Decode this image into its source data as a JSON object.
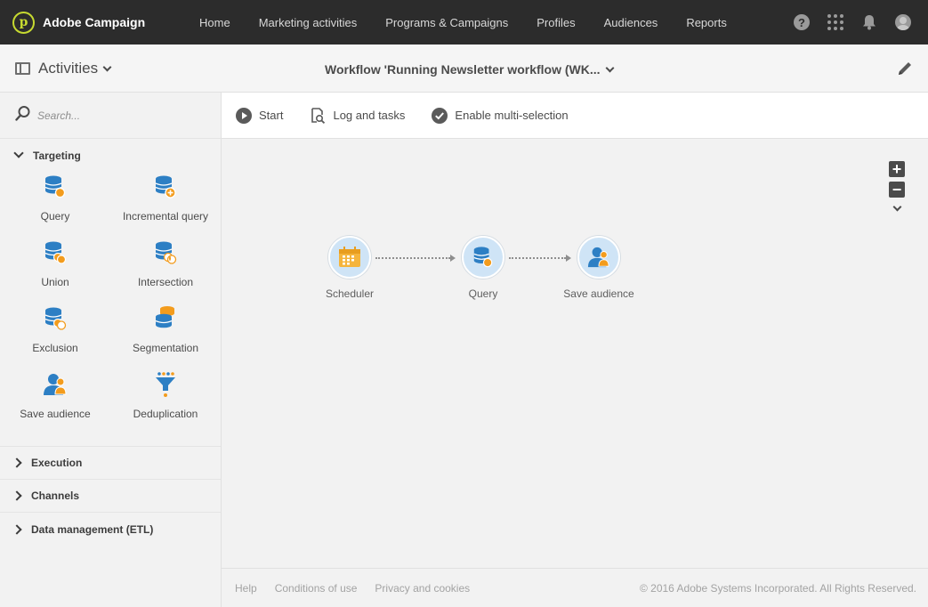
{
  "app": {
    "name": "Adobe Campaign"
  },
  "nav": {
    "items": [
      "Home",
      "Marketing activities",
      "Programs & Campaigns",
      "Profiles",
      "Audiences",
      "Reports"
    ]
  },
  "top_icons": [
    "help-icon",
    "apps-grid-icon",
    "bell-icon",
    "user-avatar-icon"
  ],
  "subbar": {
    "activities_label": "Activities",
    "workflow_title": "Workflow 'Running Newsletter workflow (WK..."
  },
  "sidebar": {
    "search_placeholder": "Search...",
    "targeting": {
      "title": "Targeting",
      "tiles": [
        {
          "label": "Query",
          "icon": "query-icon"
        },
        {
          "label": "Incremental query",
          "icon": "incremental-query-icon"
        },
        {
          "label": "Union",
          "icon": "union-icon"
        },
        {
          "label": "Intersection",
          "icon": "intersection-icon"
        },
        {
          "label": "Exclusion",
          "icon": "exclusion-icon"
        },
        {
          "label": "Segmentation",
          "icon": "segmentation-icon"
        },
        {
          "label": "Save audience",
          "icon": "save-audience-icon"
        },
        {
          "label": "Deduplication",
          "icon": "deduplication-icon"
        }
      ]
    },
    "sections": [
      "Execution",
      "Channels",
      "Data management (ETL)"
    ]
  },
  "toolbar": {
    "start": "Start",
    "log": "Log and tasks",
    "multi": "Enable multi-selection"
  },
  "workflow": {
    "nodes": [
      {
        "label": "Scheduler",
        "icon": "scheduler-icon"
      },
      {
        "label": "Query",
        "icon": "query-icon"
      },
      {
        "label": "Save audience",
        "icon": "save-audience-icon"
      }
    ]
  },
  "footer": {
    "links": [
      "Help",
      "Conditions of use",
      "Privacy and cookies"
    ],
    "copyright": "© 2016 Adobe Systems Incorporated. All Rights Reserved."
  },
  "colors": {
    "topbar": "#2c2c2c",
    "accent_blue": "#2d7fc4",
    "accent_orange": "#f39c1d",
    "logo": "#c6d930"
  }
}
